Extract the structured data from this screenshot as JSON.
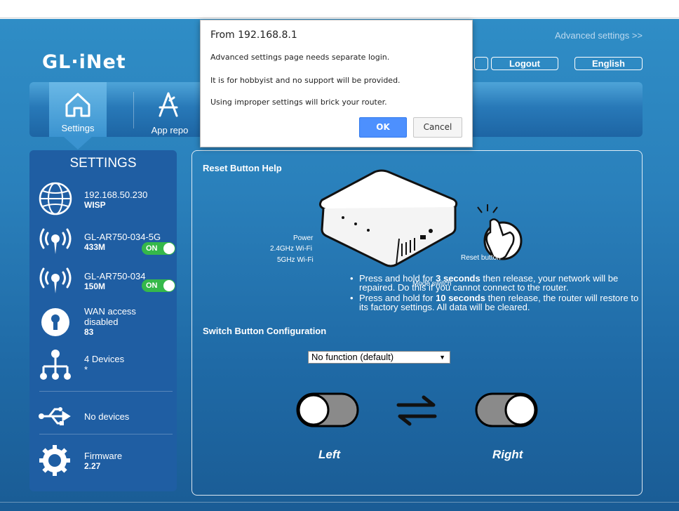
{
  "dialog": {
    "title": "From 192.168.8.1",
    "lines": [
      "Advanced settings page needs separate login.",
      "It is for hobbyist and no support will be provided.",
      "Using improper settings will brick your router."
    ],
    "ok_label": "OK",
    "cancel_label": "Cancel"
  },
  "header": {
    "logo": "GL·iNet",
    "advanced_link": "Advanced settings >>",
    "logout_label": "Logout",
    "language_label": "English"
  },
  "nav": {
    "items": [
      {
        "label": "Settings",
        "icon": "home-icon",
        "active": true
      },
      {
        "label": "App repo",
        "icon": "app-store-icon",
        "active": false
      }
    ]
  },
  "sidebar": {
    "title": "SETTINGS",
    "items": [
      {
        "name": "192.168.50.230",
        "sub": "WISP",
        "icon": "globe-icon"
      },
      {
        "name": "GL-AR750-034-5G",
        "sub": "433M",
        "icon": "wifi-antenna-icon",
        "toggle": "ON"
      },
      {
        "name": "GL-AR750-034",
        "sub": "150M",
        "icon": "wifi-antenna-icon",
        "toggle": "ON"
      },
      {
        "name": "WAN access",
        "name2": "disabled",
        "sub": "83",
        "icon": "lock-icon"
      },
      {
        "name": "4 Devices",
        "sub": "*",
        "icon": "network-icon"
      },
      {
        "name": "No devices",
        "icon": "usb-icon"
      },
      {
        "name": "Firmware",
        "sub": "2.27",
        "icon": "gear-icon"
      }
    ]
  },
  "main": {
    "reset_heading": "Reset Button Help",
    "device_labels": {
      "power": "Power",
      "wifi24": "2.4GHz Wi-Fi",
      "wifi5": "5GHz Wi-Fi",
      "mode_switch": "Mode switch",
      "reset_button": "Reset button"
    },
    "reset_points": [
      {
        "pre": "Press and hold for ",
        "bold": "3 seconds",
        "post": " then release, your network will be repaired. Do this if you cannot connect to the router."
      },
      {
        "pre": "Press and hold for ",
        "bold": "10 seconds",
        "post": " then release, the router will restore to its factory settings. All data will be cleared."
      }
    ],
    "switch_heading": "Switch Button Configuration",
    "switch_select": "No function (default)",
    "left_label": "Left",
    "right_label": "Right"
  },
  "colors": {
    "background": "#2a80bb",
    "sidebar": "#1f5ea3",
    "toggle_on": "#35b84a",
    "ok_button": "#4d90fe"
  }
}
